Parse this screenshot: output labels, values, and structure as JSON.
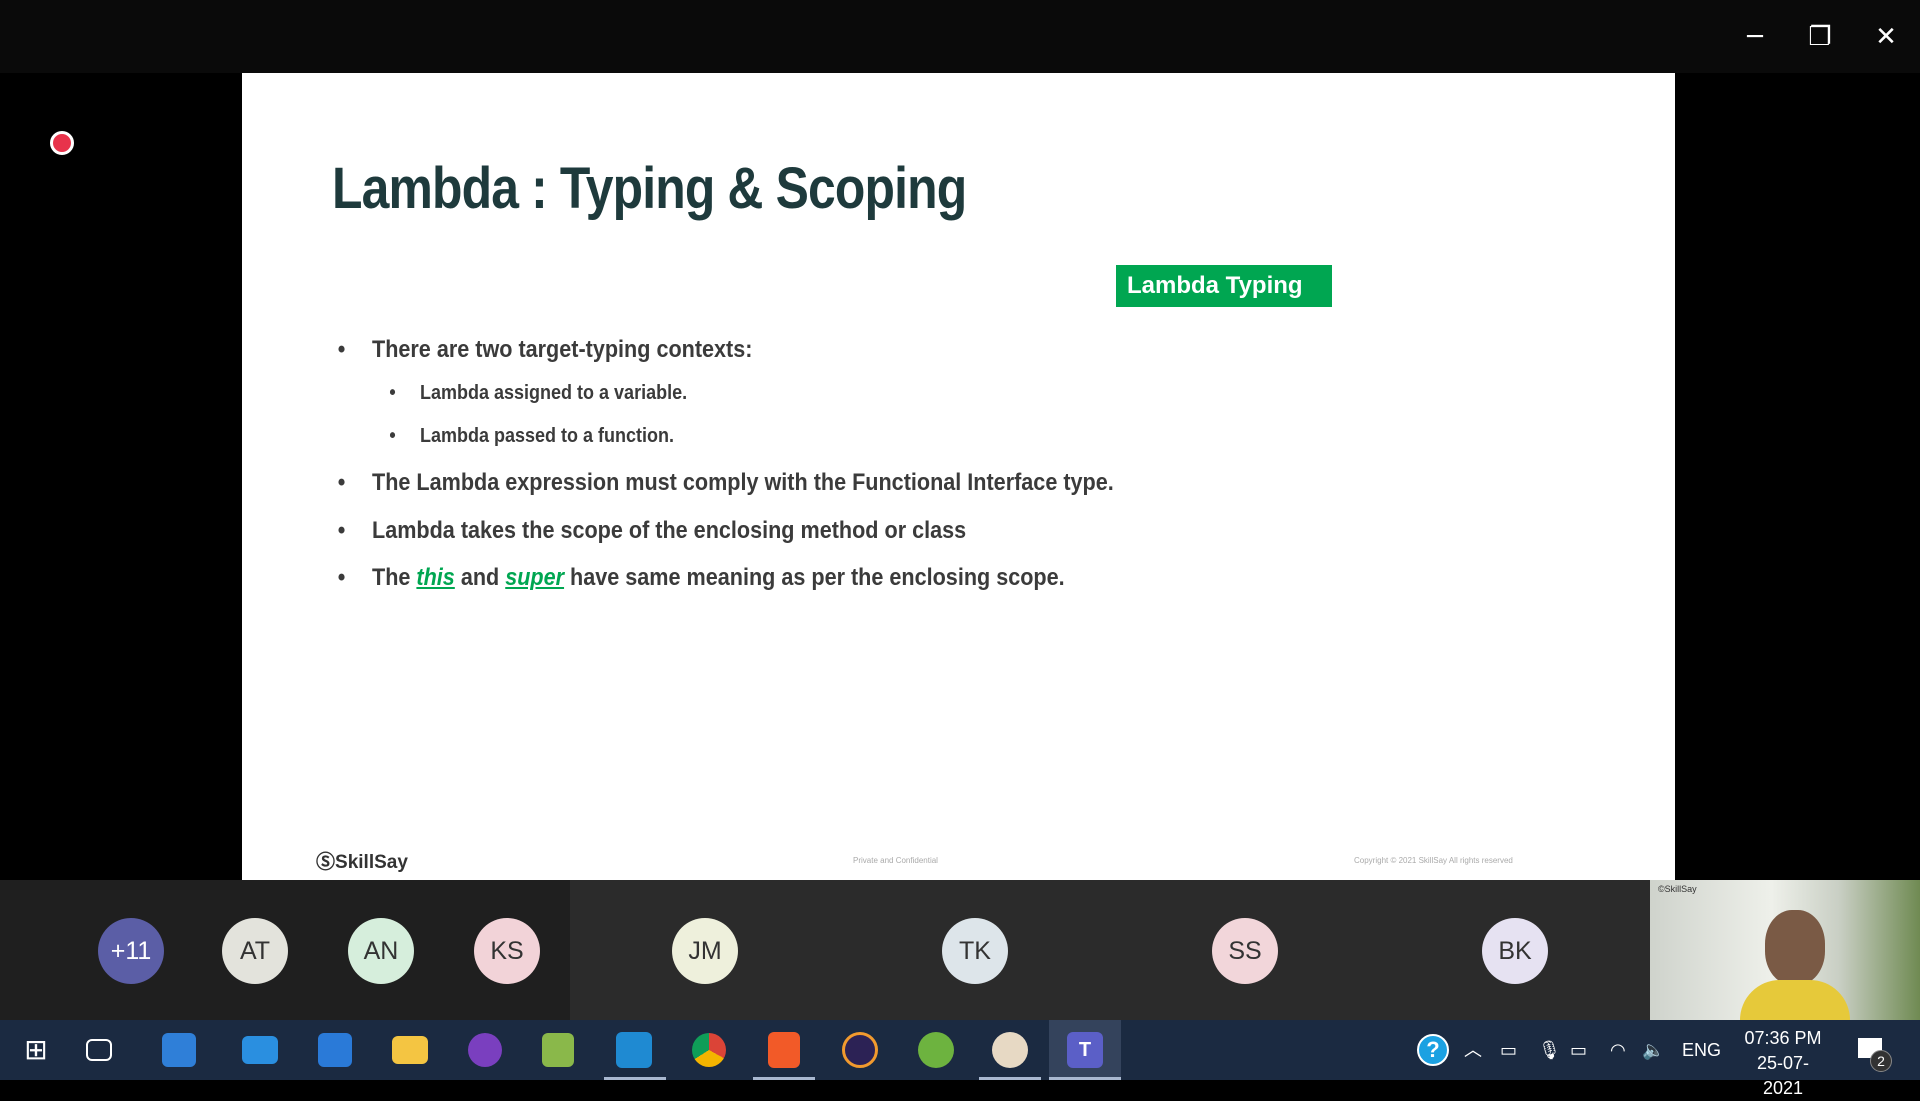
{
  "window": {
    "minimize": "─",
    "maximize": "❐",
    "close": "✕"
  },
  "slide": {
    "title": "Lambda : Typing & Scoping",
    "badge": "Lambda Typing",
    "bullets": [
      "There are two target-typing contexts:",
      "Lambda assigned to a variable.",
      "Lambda passed to a function.",
      "The Lambda expression must comply with the Functional Interface type.",
      "Lambda takes the scope of the enclosing method or class"
    ],
    "last": {
      "pre": "The ",
      "kw1": "this",
      "mid": " and ",
      "kw2": "super",
      "post": " have same meaning as per the enclosing scope."
    },
    "logo": "SkillSay",
    "footer_center": "Private and Confidential",
    "footer_right": "Copyright © 2021 SkillSay All rights reserved"
  },
  "participants": [
    {
      "initials": "+11",
      "color": "#5b5ea6"
    },
    {
      "initials": "AT",
      "color": "#e3e3dc"
    },
    {
      "initials": "AN",
      "color": "#d6eedc"
    },
    {
      "initials": "KS",
      "color": "#f2d3d8"
    },
    {
      "initials": "JM",
      "color": "#eef0dc"
    },
    {
      "initials": "TK",
      "color": "#dde5ea"
    },
    {
      "initials": "SS",
      "color": "#f2d6da"
    },
    {
      "initials": "BK",
      "color": "#e6e2f2"
    }
  ],
  "video_label": "©SkillSay",
  "tray": {
    "lang": "ENG",
    "time": "07:36 PM",
    "date": "25-07-2021",
    "notifications": "2"
  }
}
